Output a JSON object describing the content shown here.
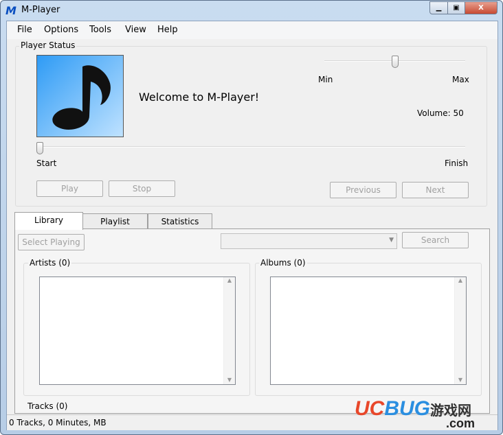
{
  "window": {
    "title": "M-Player",
    "icon": "m-logo-icon"
  },
  "menu": [
    "File",
    "Options",
    "Tools",
    "View",
    "Help"
  ],
  "player_status": {
    "label": "Player Status",
    "welcome": "Welcome to M-Player!",
    "album_art_icon": "music-note-icon",
    "volume": {
      "min_label": "Min",
      "max_label": "Max",
      "value": 50,
      "text": "Volume: 50"
    },
    "position": {
      "start_label": "Start",
      "finish_label": "Finish",
      "value": 0
    },
    "buttons": {
      "play": "Play",
      "stop": "Stop",
      "previous": "Previous",
      "next": "Next"
    }
  },
  "tabs": [
    {
      "label": "Library",
      "active": true
    },
    {
      "label": "Playlist"
    },
    {
      "label": "Statistics"
    }
  ],
  "library": {
    "select_playing": "Select Playing",
    "search": "Search",
    "dropdown_value": "",
    "artists": "Artists (0)",
    "albums": "Albums (0)",
    "tracks": "Tracks (0)"
  },
  "status_bar": "0 Tracks, 0 Minutes,  MB",
  "watermark": "UCBUG 游戏网 .com"
}
